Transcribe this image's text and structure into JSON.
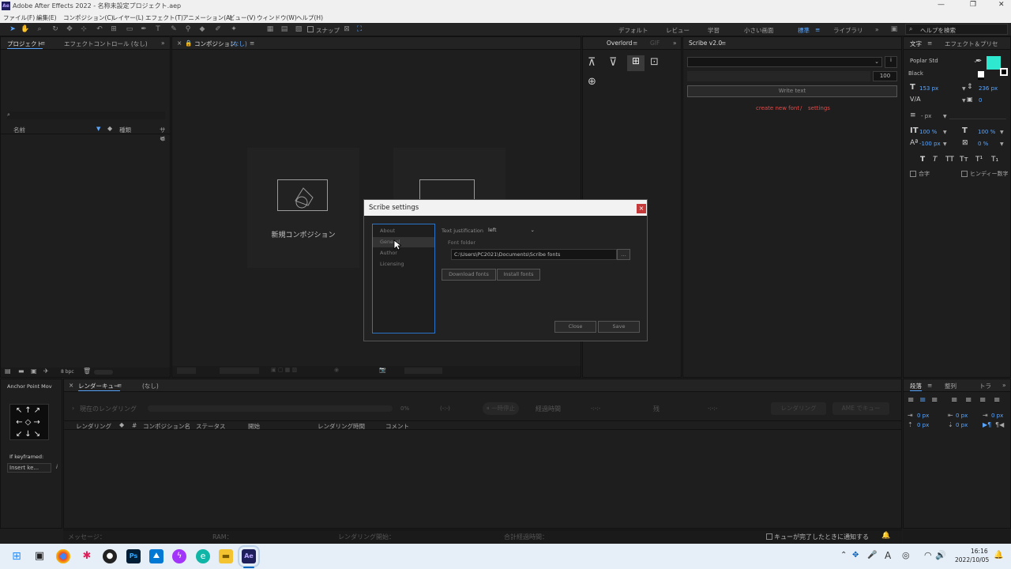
{
  "app": {
    "title": "Adobe After Effects 2022 - 名称未設定プロジェクト.aep",
    "logo": "Ae"
  },
  "menu": [
    "ファイル(F)",
    "編集(E)",
    "コンポジション(C)",
    "レイヤー(L)",
    "エフェクト(T)",
    "アニメーション(A)",
    "ビュー(V)",
    "ウィンドウ(W)",
    "ヘルプ(H)"
  ],
  "toolbar": {
    "snap_label": "スナップ",
    "workspaces": [
      "デフォルト",
      "レビュー",
      "学習",
      "小さい画面",
      "標準",
      "ライブラリ"
    ],
    "active_workspace": "標準",
    "search_placeholder": "ヘルプを検索"
  },
  "project_panel": {
    "tabs": [
      "プロジェクト",
      "エフェクトコントロール (なし)"
    ],
    "columns": [
      "名前",
      "種類",
      "サイ"
    ],
    "bpc": "8 bpc"
  },
  "comp_panel": {
    "tab": "コンポジション",
    "tab_suffix": "(なし)",
    "new_comp": "新規コンポジション"
  },
  "overlord": {
    "tabs": [
      "Overlord",
      "GIF"
    ]
  },
  "scribe": {
    "tab": "Scribe v2.0",
    "size_value": "100",
    "write_button": "Write text",
    "create_link": "create new font",
    "divider": "/",
    "settings_link": "settings"
  },
  "character": {
    "tabs": [
      "文字",
      "エフェクト＆プリセ"
    ],
    "font": "Poplar Std",
    "style": "Black",
    "size": "153 px",
    "leading": "236 px",
    "kerning": "",
    "tracking": "0",
    "stroke": "- px",
    "vscale": "100 %",
    "hscale": "100 %",
    "baseline": "-100 px",
    "tsume": "0 %",
    "styles": [
      "T",
      "T",
      "TT",
      "Tт",
      "T¹",
      "T₁"
    ],
    "ligature": "合字",
    "hindi": "ヒンディー数字",
    "swatch": "#2ee8d0"
  },
  "anchor": {
    "title": "Anchor Point Mov",
    "keyframe_label": "If keyframed:",
    "keyframe_value": "Insert ke..."
  },
  "render": {
    "tabs": [
      "レンダーキュー",
      "(なし)"
    ],
    "current": "現在のレンダリング",
    "percent": "0%",
    "time": "(-:-)",
    "pause": "一時停止",
    "elapsed": "経過時間",
    "elapsed_val": "-:-:-",
    "remain": "残",
    "remain_val": "-:-:-",
    "render_btn": "レンダリング",
    "ame_btn": "AME でキュー",
    "columns": [
      "レンダリング",
      "#",
      "コンポジション名",
      "ステータス",
      "開始",
      "レンダリング時間",
      "コメント"
    ]
  },
  "paragraph": {
    "tabs": [
      "段落",
      "整列",
      "トラ"
    ],
    "vals": [
      "0 px",
      "0 px",
      "0 px",
      "0 px",
      "0 px"
    ]
  },
  "status": {
    "message": "メッセージ：",
    "ram": "RAM：",
    "render_start": "レンダリング開始：",
    "total": "合計経過時間：",
    "notify": "キューが完了したときに通知する"
  },
  "dialog": {
    "title": "Scribe settings",
    "close_x": "×",
    "nav": [
      "About",
      "General",
      "Author",
      "Licensing"
    ],
    "active_nav": "General",
    "justify_label": "Text justification",
    "justify_value": "left",
    "folder_label": "Font folder",
    "folder_value": "C:\\Users\\PC2021\\Documents\\Scribe fonts",
    "browse": "...",
    "download": "Download fonts",
    "install": "Install fonts",
    "close": "Close",
    "save": "Save"
  },
  "taskbar": {
    "time": "16:16",
    "date": "2022/10/05",
    "apps": [
      "windows",
      "file-explorer",
      "chrome",
      "slack",
      "github",
      "photoshop",
      "photos",
      "messenger",
      "edge",
      "folder",
      "after-effects"
    ]
  }
}
